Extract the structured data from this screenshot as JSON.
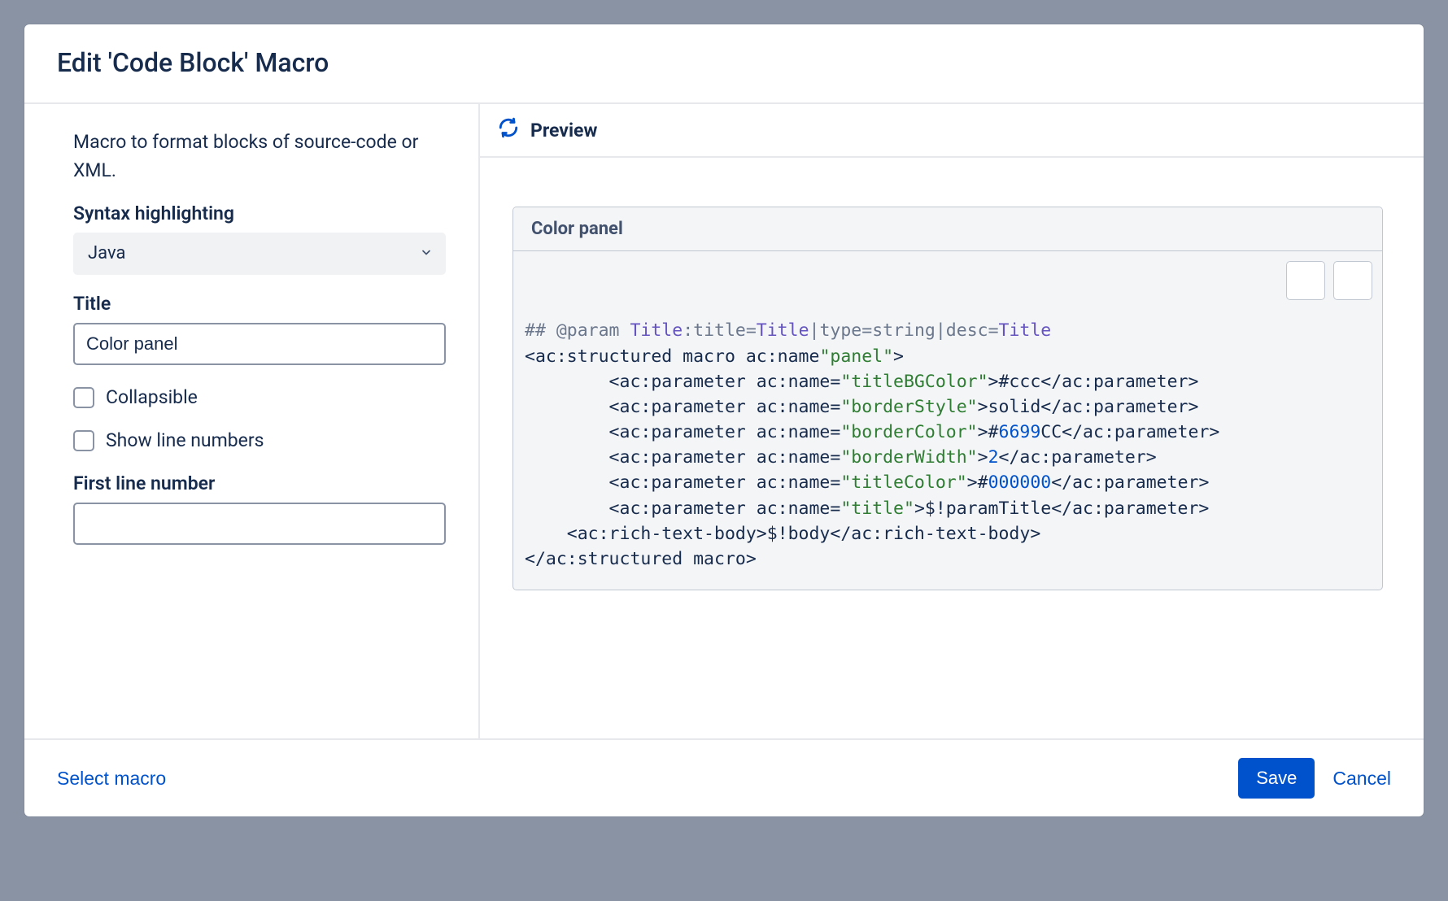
{
  "dialog": {
    "title": "Edit 'Code Block' Macro"
  },
  "form": {
    "description": "Macro to format blocks of source-code or XML.",
    "syntax_label": "Syntax highlighting",
    "syntax_value": "Java",
    "title_label": "Title",
    "title_value": "Color panel",
    "collapsible_label": "Collapsible",
    "collapsible_checked": false,
    "line_numbers_label": "Show line numbers",
    "line_numbers_checked": false,
    "first_line_label": "First line number",
    "first_line_value": ""
  },
  "preview": {
    "header": "Preview",
    "code_title": "Color panel",
    "tokens": [
      [
        {
          "t": "## @param ",
          "c": "gray"
        },
        {
          "t": "Title",
          "c": "purple"
        },
        {
          "t": ":title=",
          "c": "gray"
        },
        {
          "t": "Title",
          "c": "purple"
        },
        {
          "t": "|type=string|desc=",
          "c": "gray"
        },
        {
          "t": "Title",
          "c": "purple"
        }
      ],
      [
        {
          "t": "<ac:structured macro ac:name",
          "c": "text"
        },
        {
          "t": "\"panel\"",
          "c": "dgreen"
        },
        {
          "t": ">",
          "c": "text"
        }
      ],
      [
        {
          "t": "        <ac:parameter ac:name=",
          "c": "text"
        },
        {
          "t": "\"titleBGColor\"",
          "c": "dgreen"
        },
        {
          "t": ">#ccc</ac:parameter>",
          "c": "text"
        }
      ],
      [
        {
          "t": "        <ac:parameter ac:name=",
          "c": "text"
        },
        {
          "t": "\"borderStyle\"",
          "c": "dgreen"
        },
        {
          "t": ">solid</ac:parameter>",
          "c": "text"
        }
      ],
      [
        {
          "t": "        <ac:parameter ac:name=",
          "c": "text"
        },
        {
          "t": "\"borderColor\"",
          "c": "dgreen"
        },
        {
          "t": ">#",
          "c": "text"
        },
        {
          "t": "6699",
          "c": "blue"
        },
        {
          "t": "CC</ac:parameter>",
          "c": "text"
        }
      ],
      [
        {
          "t": "        <ac:parameter ac:name=",
          "c": "text"
        },
        {
          "t": "\"borderWidth\"",
          "c": "dgreen"
        },
        {
          "t": ">",
          "c": "text"
        },
        {
          "t": "2",
          "c": "blue"
        },
        {
          "t": "</ac:parameter>",
          "c": "text"
        }
      ],
      [
        {
          "t": "        <ac:parameter ac:name=",
          "c": "text"
        },
        {
          "t": "\"titleColor\"",
          "c": "dgreen"
        },
        {
          "t": ">#",
          "c": "text"
        },
        {
          "t": "000000",
          "c": "blue"
        },
        {
          "t": "</ac:parameter>",
          "c": "text"
        }
      ],
      [
        {
          "t": "        <ac:parameter ac:name=",
          "c": "text"
        },
        {
          "t": "\"title\"",
          "c": "dgreen"
        },
        {
          "t": ">$!paramTitle</ac:parameter>",
          "c": "text"
        }
      ],
      [
        {
          "t": "    <ac:rich-text-body>$!body</ac:rich-text-body>",
          "c": "text"
        }
      ],
      [
        {
          "t": "</ac:structured macro>",
          "c": "text"
        }
      ]
    ]
  },
  "footer": {
    "select_macro": "Select macro",
    "save": "Save",
    "cancel": "Cancel"
  }
}
